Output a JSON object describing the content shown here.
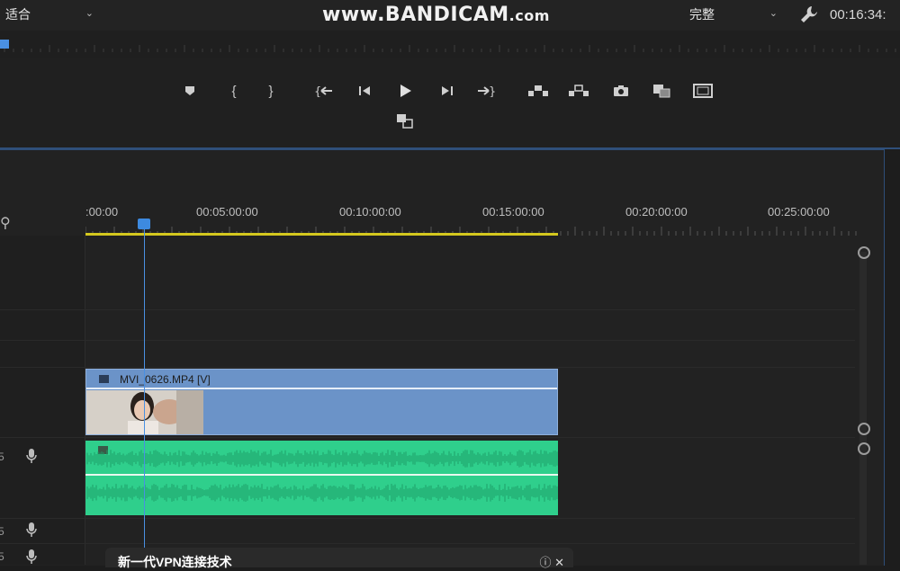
{
  "toolbar": {
    "zoom_value": "适合",
    "quality_value": "完整",
    "timecode": "00:16:34:"
  },
  "watermark": {
    "main": "www.BANDICAM",
    "suffix": ".com"
  },
  "transport": {
    "buttons": [
      "marker-icon",
      "mark-in-icon",
      "mark-out-icon",
      "go-to-in-icon",
      "step-back-icon",
      "play-icon",
      "step-forward-icon",
      "go-to-out-icon",
      "lift-icon",
      "extract-icon",
      "export-frame-icon",
      "comparison-view-icon",
      "safe-margins-icon",
      "proxy-toggle-icon"
    ]
  },
  "ruler": {
    "labels": [
      ":00:00",
      "00:05:00:00",
      "00:10:00:00",
      "00:15:00:00",
      "00:20:00:00",
      "00:25:00:00"
    ]
  },
  "clips": {
    "video_label": "MVI_0626.MP4 [V]"
  },
  "popup": {
    "text": "新一代VPN连接技术",
    "controls": "ⓘ ✕"
  },
  "colors": {
    "video_clip": "#6b93c8",
    "audio_clip": "#2fcf8c",
    "playhead": "#4a90e2",
    "work_area": "#d4c81e"
  }
}
